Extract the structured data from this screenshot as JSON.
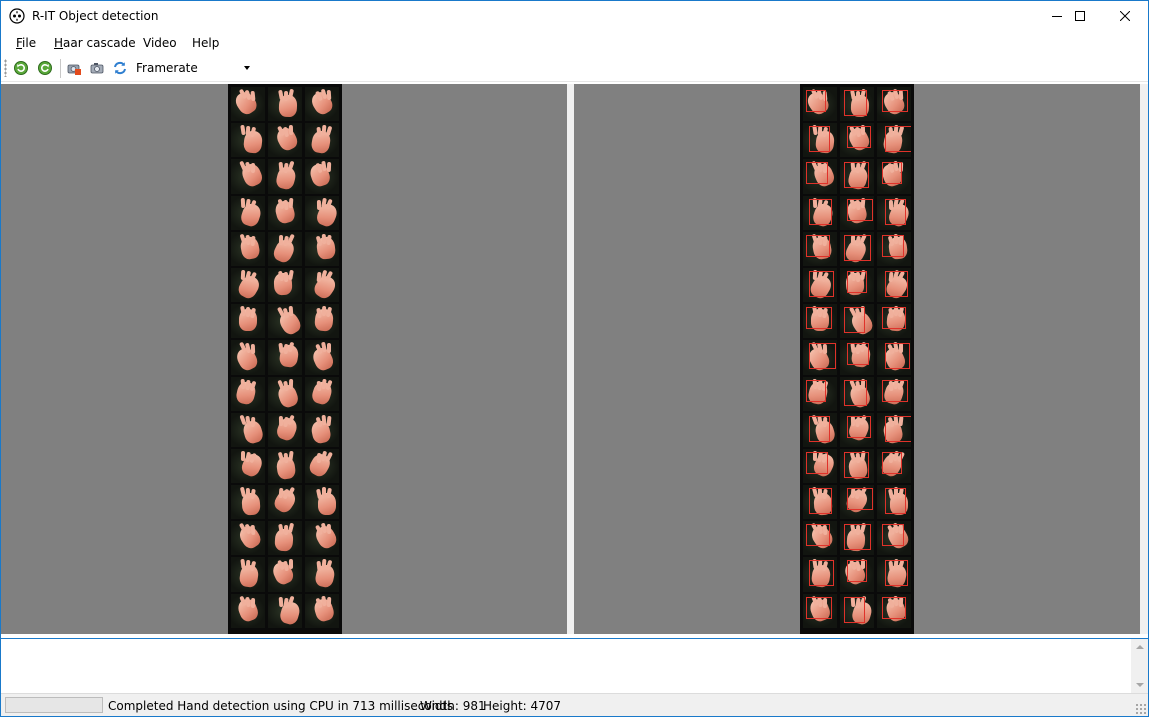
{
  "window": {
    "title": "R-IT Object detection",
    "controls": [
      "minimize-icon",
      "maximize-icon",
      "close-icon"
    ]
  },
  "menu": {
    "items": [
      {
        "label": "File",
        "accel": "F",
        "rest": "ile"
      },
      {
        "label": "Haar cascade",
        "accel": "H",
        "rest": "aar cascade"
      },
      {
        "label": "Video",
        "accel": "",
        "rest": "Video"
      },
      {
        "label": "Help",
        "accel": "",
        "rest": "Help"
      }
    ]
  },
  "toolbar": {
    "buttons": [
      "rotate-left-icon",
      "rotate-right-icon",
      "camera-stop-icon",
      "camera-icon",
      "refresh-icon"
    ],
    "framerate": {
      "selected": "Framerate"
    }
  },
  "panes": {
    "left": {
      "rows": 15,
      "columns": 3,
      "detections": false
    },
    "right": {
      "rows": 15,
      "columns": 3,
      "detections": true
    }
  },
  "log": {
    "text": ""
  },
  "status": {
    "message": "Completed Hand detection using CPU in 713 milliseconds",
    "width": "Width: 981",
    "height": "Height: 4707"
  },
  "colors": {
    "pane_background": "#808080",
    "detection_box": "#e0322a",
    "window_border": "#1979ca"
  }
}
